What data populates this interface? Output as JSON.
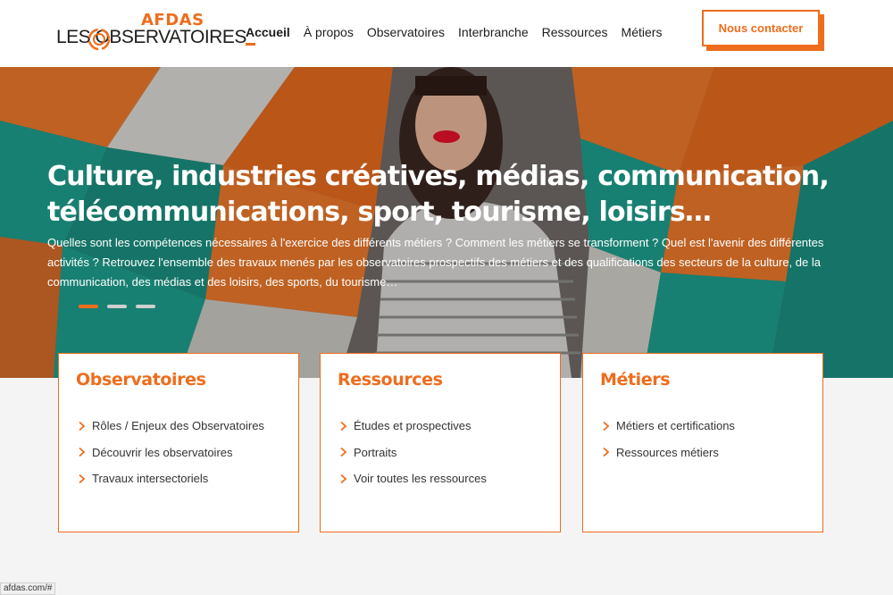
{
  "header": {
    "logo": {
      "brand": "AFDAS",
      "main": "LES  OBSERVATOIRES"
    },
    "nav": [
      {
        "label": "Accueil",
        "active": true
      },
      {
        "label": "À propos"
      },
      {
        "label": "Observatoires"
      },
      {
        "label": "Interbranche"
      },
      {
        "label": "Ressources"
      },
      {
        "label": "Métiers"
      }
    ],
    "contact_label": "Nous contacter"
  },
  "hero": {
    "title": "Culture, industries créatives, médias, communication, télécommunications, sport, tourisme, loisirs…",
    "text": "Quelles sont les compétences nécessaires à l'exercice des différents métiers ? Comment les métiers se transforment ? Quel est l'avenir des différentes activités ? Retrouvez l'ensemble des travaux menés par les observatoires prospectifs des métiers et des qualifications des secteurs de la culture, de la communication, des médias et des loisirs, des sports, du tourisme…",
    "slides_count": 3,
    "active_slide": 1
  },
  "cards": [
    {
      "title": "Observatoires",
      "links": [
        "Rôles / Enjeux des Observatoires",
        "Découvrir les observatoires",
        "Travaux intersectoriels"
      ]
    },
    {
      "title": "Ressources",
      "links": [
        "Études et prospectives",
        "Portraits",
        "Voir toutes les ressources"
      ]
    },
    {
      "title": "Métiers",
      "links": [
        "Métiers et certifications",
        "Ressources métiers"
      ]
    }
  ],
  "status_url": "afdas.com/#",
  "colors": {
    "accent": "#ee6d1d",
    "teal": "#1e9d8b",
    "text": "#1d1d1b"
  },
  "icons": {
    "chevron": "chevron-right-icon",
    "logo_ring": "ring-icon"
  }
}
